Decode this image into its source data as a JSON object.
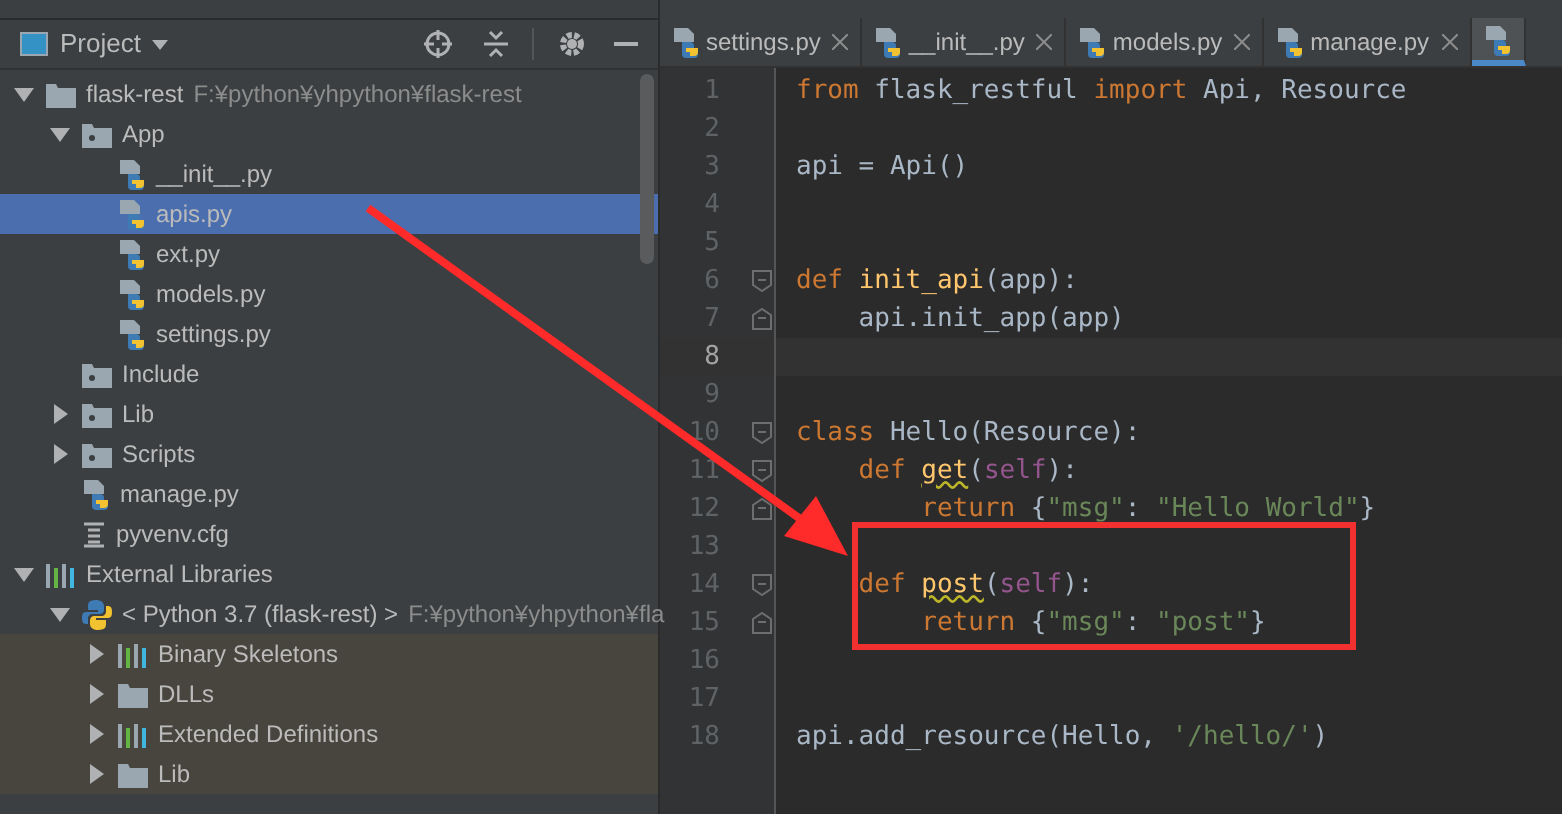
{
  "project_panel": {
    "title": "Project"
  },
  "tree": [
    {
      "kind": "root-folder",
      "label": "flask-rest",
      "hint": "F:¥python¥yhpython¥flask-rest",
      "expanded": true,
      "selected": false,
      "children": [
        {
          "kind": "module-folder",
          "label": "App",
          "expanded": true,
          "selected": false,
          "children": [
            {
              "kind": "python-file",
              "label": "__init__.py",
              "selected": false
            },
            {
              "kind": "python-file",
              "label": "apis.py",
              "selected": true
            },
            {
              "kind": "python-file",
              "label": "ext.py",
              "selected": false
            },
            {
              "kind": "python-file",
              "label": "models.py",
              "selected": false
            },
            {
              "kind": "python-file",
              "label": "settings.py",
              "selected": false
            }
          ]
        },
        {
          "kind": "module-folder",
          "label": "Include",
          "selected": false
        },
        {
          "kind": "module-folder",
          "label": "Lib",
          "expanded": false,
          "selected": false
        },
        {
          "kind": "module-folder",
          "label": "Scripts",
          "expanded": false,
          "selected": false
        },
        {
          "kind": "python-file",
          "label": "manage.py",
          "selected": false
        },
        {
          "kind": "config-file",
          "label": "pyvenv.cfg",
          "selected": false
        }
      ]
    },
    {
      "kind": "library",
      "label": "External Libraries",
      "expanded": true,
      "selected": false,
      "children": [
        {
          "kind": "python-sdk",
          "label": "< Python 3.7 (flask-rest) >",
          "hint": "F:¥python¥yhpython¥fla",
          "expanded": true,
          "selected": false,
          "children": [
            {
              "kind": "library",
              "label": "Binary Skeletons",
              "expanded": false,
              "selected": false
            },
            {
              "kind": "folder",
              "label": "DLLs",
              "expanded": false,
              "selected": false
            },
            {
              "kind": "library",
              "label": "Extended Definitions",
              "expanded": false,
              "selected": false
            },
            {
              "kind": "folder",
              "label": "Lib",
              "expanded": false,
              "selected": false
            }
          ]
        }
      ]
    }
  ],
  "tabs": [
    {
      "label": "settings.py",
      "selected": false
    },
    {
      "label": "__init__.py",
      "selected": false
    },
    {
      "label": "models.py",
      "selected": false
    },
    {
      "label": "manage.py",
      "selected": false
    },
    {
      "selected": true
    }
  ],
  "code": [
    {
      "number": "1",
      "current": false,
      "tokens": [
        {
          "kind": "keyword",
          "text": "from"
        },
        {
          "kind": "plain",
          "text": " flask_restful "
        },
        {
          "kind": "keyword",
          "text": "import"
        },
        {
          "kind": "plain",
          "text": " Api, Resource"
        }
      ]
    },
    {
      "number": "2",
      "current": false
    },
    {
      "number": "3",
      "current": false,
      "tokens": [
        {
          "kind": "plain",
          "text": "api = Api()"
        }
      ]
    },
    {
      "number": "4",
      "current": false
    },
    {
      "number": "5",
      "current": false
    },
    {
      "number": "6",
      "current": false,
      "fold_start": true,
      "tokens": [
        {
          "kind": "keyword",
          "text": "def "
        },
        {
          "kind": "function",
          "text": "init_api"
        },
        {
          "kind": "plain",
          "text": "(app):"
        }
      ]
    },
    {
      "number": "7",
      "current": false,
      "fold_start": false,
      "tokens": [
        {
          "kind": "plain",
          "text": "    api.init_app(app)"
        }
      ]
    },
    {
      "number": "8",
      "current": true
    },
    {
      "number": "9",
      "current": false
    },
    {
      "number": "10",
      "current": false,
      "fold_start": true,
      "tokens": [
        {
          "kind": "keyword",
          "text": "class"
        },
        {
          "kind": "plain",
          "text": " Hello(Resource):"
        }
      ]
    },
    {
      "number": "11",
      "current": false,
      "fold_start": true,
      "tokens": [
        {
          "kind": "keyword",
          "text": "    def "
        },
        {
          "kind": "function",
          "text": "get",
          "warning": true
        },
        {
          "kind": "plain",
          "text": "("
        },
        {
          "kind": "self",
          "text": "self"
        },
        {
          "kind": "plain",
          "text": "):"
        }
      ]
    },
    {
      "number": "12",
      "current": false,
      "fold_start": false,
      "tokens": [
        {
          "kind": "keyword",
          "text": "        return"
        },
        {
          "kind": "plain",
          "text": " {"
        },
        {
          "kind": "string",
          "text": "\"msg\""
        },
        {
          "kind": "plain",
          "text": ": "
        },
        {
          "kind": "string",
          "text": "\"Hello World\""
        },
        {
          "kind": "plain",
          "text": "}"
        }
      ]
    },
    {
      "number": "13",
      "current": false
    },
    {
      "number": "14",
      "current": false,
      "fold_start": true,
      "tokens": [
        {
          "kind": "keyword",
          "text": "    def "
        },
        {
          "kind": "function",
          "text": "post",
          "warning": true
        },
        {
          "kind": "plain",
          "text": "("
        },
        {
          "kind": "self",
          "text": "self"
        },
        {
          "kind": "plain",
          "text": "):"
        }
      ]
    },
    {
      "number": "15",
      "current": false,
      "fold_start": false,
      "tokens": [
        {
          "kind": "keyword",
          "text": "        return"
        },
        {
          "kind": "plain",
          "text": " {"
        },
        {
          "kind": "string",
          "text": "\"msg\""
        },
        {
          "kind": "plain",
          "text": ": "
        },
        {
          "kind": "string",
          "text": "\"post\""
        },
        {
          "kind": "plain",
          "text": "}"
        }
      ]
    },
    {
      "number": "16",
      "current": false
    },
    {
      "number": "17",
      "current": false
    },
    {
      "number": "18",
      "current": false,
      "tokens": [
        {
          "kind": "plain",
          "text": "api.add_resource(Hello, "
        },
        {
          "kind": "string",
          "text": "'/hello/'"
        },
        {
          "kind": "plain",
          "text": ")"
        }
      ]
    }
  ]
}
